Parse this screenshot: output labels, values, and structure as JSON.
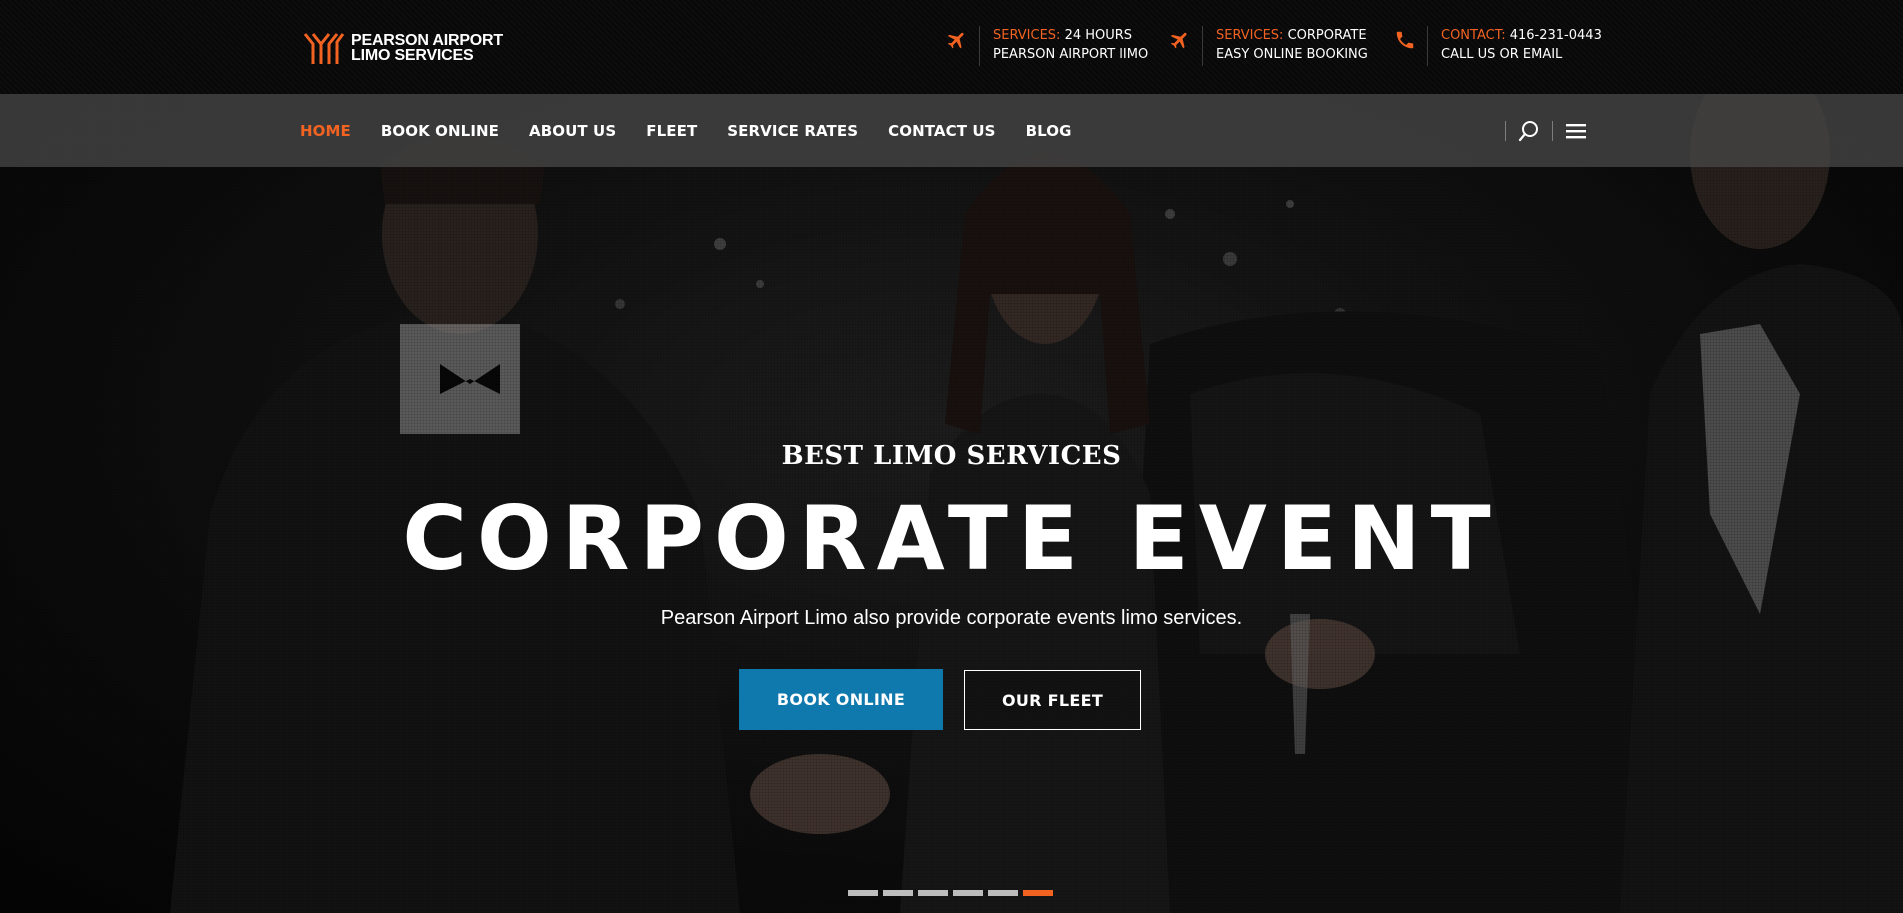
{
  "brand": {
    "line1": "PEARSON AIRPORT",
    "line2": "LIMO SERVICES",
    "accent_color": "#f26322"
  },
  "header_info": [
    {
      "icon": "airplane-icon",
      "label": "SERVICES:",
      "value": " 24 HOURS",
      "line2": "PEARSON AIRPORT lIMO"
    },
    {
      "icon": "airplane-icon",
      "label": "SERVICES:",
      "value": " CORPORATE",
      "line2": "EASY ONLINE BOOKING"
    },
    {
      "icon": "phone-icon",
      "label": "CONTACT:",
      "value": " 416-231-0443",
      "line2": "CALL US OR EMAIL"
    }
  ],
  "nav": {
    "items": [
      {
        "label": "HOME",
        "active": true
      },
      {
        "label": "BOOK ONLINE",
        "active": false
      },
      {
        "label": "ABOUT US",
        "active": false
      },
      {
        "label": "FLEET",
        "active": false
      },
      {
        "label": "SERVICE RATES",
        "active": false
      },
      {
        "label": "CONTACT US",
        "active": false
      },
      {
        "label": "BLOG",
        "active": false
      }
    ],
    "tools": [
      "search-icon",
      "menu-icon"
    ]
  },
  "hero": {
    "eyebrow": "BEST LIMO SERVICES",
    "headline": "CORPORATE EVENT",
    "subline": "Pearson Airport Limo also provide corporate events limo services.",
    "primary_button": "BOOK ONLINE",
    "secondary_button": "OUR FLEET",
    "primary_color": "#0f78ad",
    "slides_total": 6,
    "active_slide": 6
  }
}
